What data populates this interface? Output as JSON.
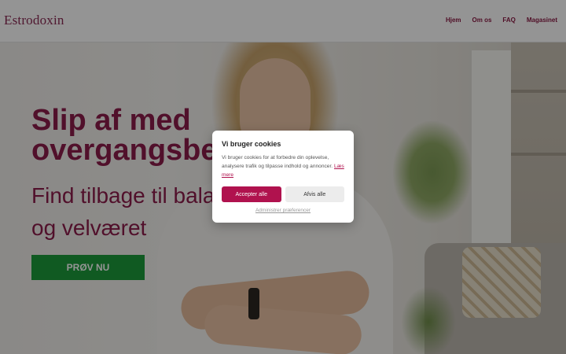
{
  "header": {
    "logo": "Estrodoxin",
    "nav": [
      "Hjem",
      "Om os",
      "FAQ",
      "Magasinet"
    ]
  },
  "hero": {
    "title": "Slip af med\novergangsbes",
    "subtitle": "Find tilbage til bala\nog velværet",
    "cta_label": "PRØV NU"
  },
  "cookie_modal": {
    "title": "Vi bruger cookies",
    "text": "Vi bruger cookies for at forbedre din oplevelse, analysere trafik og tilpasse indhold og annoncer.",
    "read_more": "Læs mere",
    "accept_label": "Accepter alle",
    "reject_label": "Afvis alle",
    "preferences_label": "Administrer præferencer"
  },
  "colors": {
    "brand": "#8c1d4b",
    "accent": "#b0124e",
    "cta": "#1d9b3c"
  }
}
